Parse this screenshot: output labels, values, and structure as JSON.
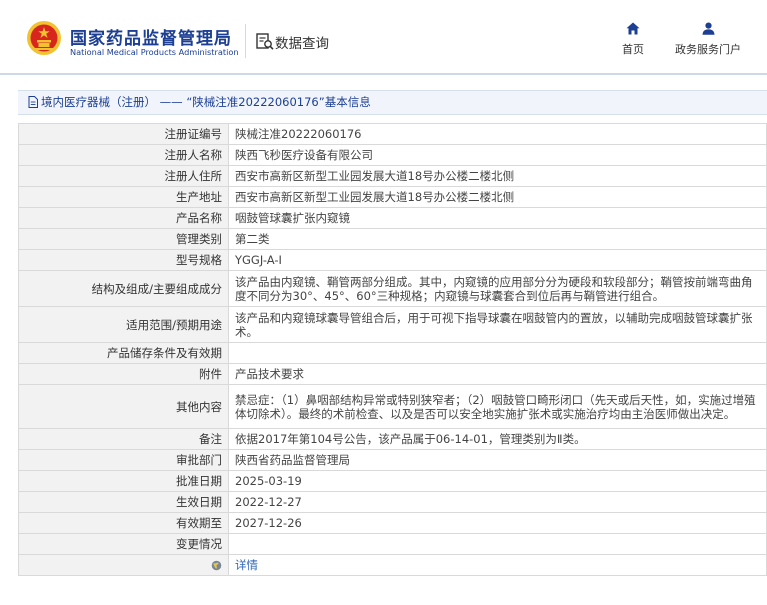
{
  "header": {
    "brand_cn": "国家药品监督管理局",
    "brand_en": "National Medical Products Administration",
    "query_label": "数据查询",
    "nav_home": "首页",
    "nav_portal": "政务服务门户"
  },
  "breadcrumb": {
    "section": "境内医疗器械（注册）",
    "separator": "——",
    "record": "“陕械注准20222060176”基本信息"
  },
  "rows": [
    {
      "label": "注册证编号",
      "value": "陕械注准20222060176"
    },
    {
      "label": "注册人名称",
      "value": "陕西飞秒医疗设备有限公司"
    },
    {
      "label": "注册人住所",
      "value": "西安市高新区新型工业园发展大道18号办公楼二楼北侧"
    },
    {
      "label": "生产地址",
      "value": "西安市高新区新型工业园发展大道18号办公楼二楼北侧"
    },
    {
      "label": "产品名称",
      "value": "咽鼓管球囊扩张内窥镜"
    },
    {
      "label": "管理类别",
      "value": "第二类"
    },
    {
      "label": "型号规格",
      "value": "YGGJ-A-I"
    },
    {
      "label": "结构及组成/主要组成成分",
      "value": "该产品由内窥镜、鞘管两部分组成。其中，内窥镜的应用部分分为硬段和软段部分；鞘管按前端弯曲角度不同分为30°、45°、60°三种规格；内窥镜与球囊套合到位后再与鞘管进行组合。"
    },
    {
      "label": "适用范围/预期用途",
      "value": "该产品和内窥镜球囊导管组合后，用于可视下指导球囊在咽鼓管内的置放，以辅助完成咽鼓管球囊扩张术。"
    },
    {
      "label": "产品储存条件及有效期",
      "value": ""
    },
    {
      "label": "附件",
      "value": "产品技术要求"
    },
    {
      "label": "其他内容",
      "value": "禁忌症：（1）鼻咽部结构异常或特别狭窄者；（2）咽鼓管口畸形闭口（先天或后天性，如，实施过增殖体切除术）。最终的术前检查、以及是否可以安全地实施扩张术或实施治疗均由主治医师做出决定。"
    },
    {
      "label": "备注",
      "value": "依据2017年第104号公告，该产品属于06-14-01，管理类别为Ⅱ类。"
    },
    {
      "label": "审批部门",
      "value": "陕西省药品监督管理局"
    },
    {
      "label": "批准日期",
      "value": "2025-03-19"
    },
    {
      "label": "生效日期",
      "value": "2022-12-27"
    },
    {
      "label": "有效期至",
      "value": "2027-12-26"
    },
    {
      "label": "变更情况",
      "value": ""
    }
  ],
  "footer_row": {
    "link": "详情"
  },
  "icons": {
    "emblem": "national-emblem-icon",
    "query": "data-query-icon",
    "home": "home-icon",
    "portal": "user-icon",
    "breadcrumb": "document-icon",
    "detail": "globe-icon"
  },
  "colors": {
    "brand": "#1c3f94",
    "link": "#2f67b8",
    "label_bg": "#f2f2f2",
    "emblem_red": "#d7261e",
    "emblem_gold": "#f2c230"
  }
}
